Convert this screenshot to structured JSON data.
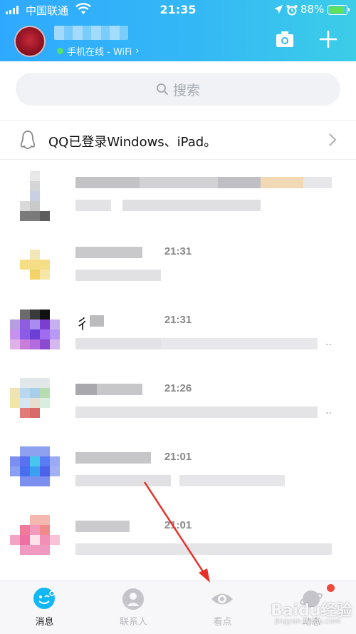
{
  "status_bar": {
    "carrier": "中国联通",
    "time": "21:35",
    "battery": "88%",
    "battery_level": 0.88
  },
  "header": {
    "online_status": "手机在线 - WiFi",
    "online_chevron": "›",
    "icons": [
      "camera-icon",
      "plus-icon"
    ]
  },
  "search": {
    "placeholder": "搜索",
    "icon": "search-icon"
  },
  "login_notice": {
    "text": "QQ已登录Windows、iPad。",
    "icon": "penguin-icon"
  },
  "chats": [
    {
      "time": "",
      "has_more": false
    },
    {
      "time": "21:31",
      "has_more": false
    },
    {
      "time": "21:31",
      "has_more": true,
      "name_prefix": "彳"
    },
    {
      "time": "21:26",
      "has_more": true
    },
    {
      "time": "21:01",
      "has_more": false
    },
    {
      "time": "21:01",
      "has_more": false
    }
  ],
  "more_glyph": "..",
  "tabs": [
    {
      "label": "消息",
      "icon": "messages-icon",
      "active": true
    },
    {
      "label": "联系人",
      "icon": "contacts-icon",
      "active": false
    },
    {
      "label": "看点",
      "icon": "eye-icon",
      "active": false
    },
    {
      "label": "动态",
      "icon": "planet-icon",
      "active": false,
      "badge": true
    }
  ],
  "watermark": {
    "logo": "Baidu经验",
    "url": "jingyan.baidu.com"
  },
  "colors": {
    "header_start": "#2fa9ff",
    "header_end": "#3ccde8",
    "accent": "#12b7f5",
    "badge": "#f0493c",
    "annotation_arrow": "#e8302a"
  }
}
